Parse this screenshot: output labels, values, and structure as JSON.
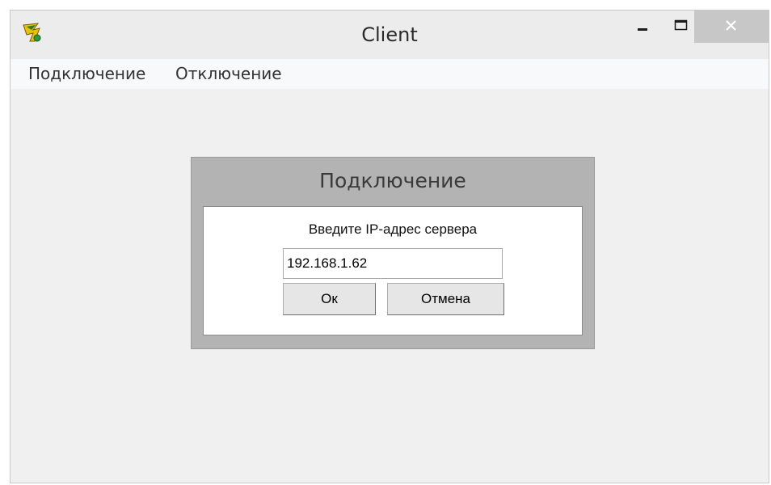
{
  "window": {
    "title": "Client",
    "app_icon": "app-logo-icon",
    "controls": {
      "minimize_icon": "minimize-icon",
      "maximize_icon": "maximize-icon",
      "close_icon": "close-icon"
    }
  },
  "menubar": {
    "items": [
      {
        "label": "Подключение"
      },
      {
        "label": "Отключение"
      }
    ]
  },
  "dialog": {
    "title": "Подключение",
    "prompt": "Введите IP-адрес сервера",
    "ip_value": "192.168.1.62",
    "ok_label": "Ок",
    "cancel_label": "Отмена"
  },
  "colors": {
    "window_bg": "#f0f0f0",
    "dialog_bg": "#b3b3b3",
    "close_button_bg": "#c7c7c7",
    "menubar_bg": "#f7f9fb"
  }
}
